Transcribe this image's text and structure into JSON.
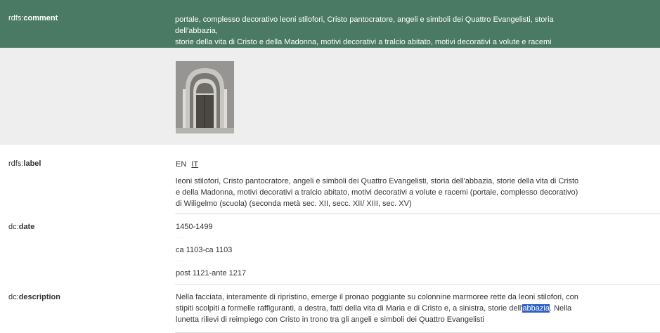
{
  "comment": {
    "key_ns": "rdfs:",
    "key_prop": "comment",
    "value_line1": "portale, complesso decorativo leoni stilofori, Cristo pantocratore, angeli e simboli dei Quattro Evangelisti, storia dell'abbazia,",
    "value_line2": "storie della vita di Cristo e della Madonna, motivi decorativi a tralcio abitato, motivi decorativi a volute e racemi"
  },
  "image": {
    "alt": "portale"
  },
  "label": {
    "key_ns": "rdfs:",
    "key_prop": "label",
    "langs": [
      "EN",
      "IT"
    ],
    "active_lang": "IT",
    "text": "leoni stilofori, Cristo pantocratore, angeli e simboli dei Quattro Evangelisti, storia dell'abbazia, storie della vita di Cristo e della Madonna, motivi decorativi a tralcio abitato, motivi decorativi a volute e racemi (portale, complesso decorativo) di Wiligelmo (scuola) (seconda metà sec. XII, secc. XII/ XIII, sec. XV)"
  },
  "date": {
    "key_ns": "dc:",
    "key_prop": "date",
    "values": [
      "1450-1499",
      "ca 1103-ca 1103",
      "post 1121-ante 1217"
    ]
  },
  "description": {
    "key_ns": "dc:",
    "key_prop": "description",
    "text_before": "Nella facciata, interamente di ripristino, emerge il pronao poggiante su colonnine marmoree rette da leoni stilofori, con stipiti scolpiti a formelle raffiguranti, a destra, fatti della vita di Maria e di Cristo e, a sinistra, storie dell'",
    "highlight": "abbazia",
    "text_after": ". Nella lunetta rilievi di reimpiego con Cristo in trono tra gli angeli e simboli dei Quattro Evangelisti"
  },
  "colors": {
    "header_bg": "#4a7a63",
    "image_row_bg": "#eeeeee",
    "highlight": "#2f5fc4"
  }
}
